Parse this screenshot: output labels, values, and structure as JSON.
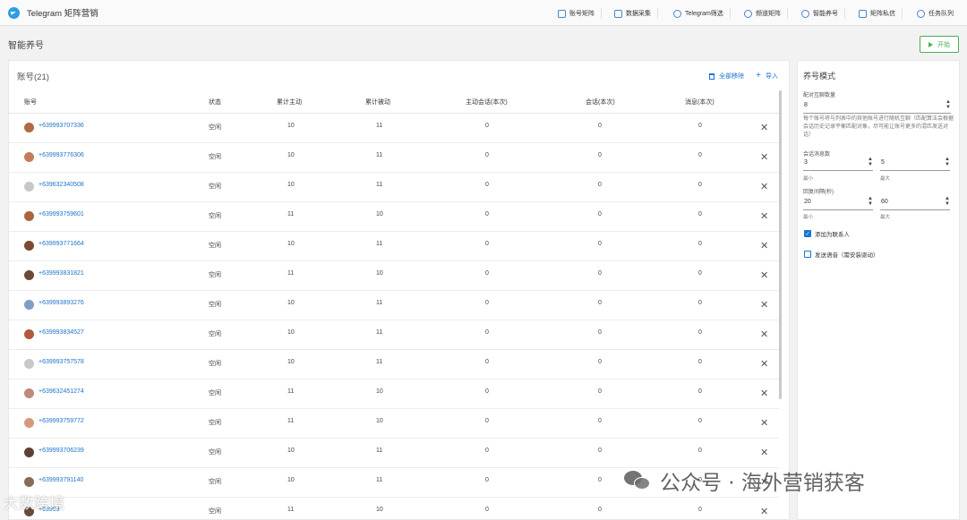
{
  "app": {
    "title": "Telegram 矩阵营销"
  },
  "nav": [
    {
      "label": "账号矩阵"
    },
    {
      "label": "数据采集"
    },
    {
      "label": "Telegram筛选"
    },
    {
      "label": "频道矩阵"
    },
    {
      "label": "智能养号"
    },
    {
      "label": "矩阵私信"
    },
    {
      "label": "任务队列"
    }
  ],
  "page": {
    "title": "智能养号",
    "start_label": "开始"
  },
  "accounts": {
    "title": "账号(21)",
    "remove_all_label": "全部移除",
    "import_label": "导入",
    "columns": [
      "账号",
      "状态",
      "累计主动",
      "累计被动",
      "主动会话(本次)",
      "会话(本次)",
      "消息(本次)"
    ],
    "rows": [
      {
        "phone": "+639993707336",
        "status": "空闲",
        "active_total": "10",
        "passive_total": "11",
        "active_sessions": "0",
        "sessions": "0",
        "messages": "0",
        "avatar": "#b06a45"
      },
      {
        "phone": "+639993776306",
        "status": "空闲",
        "active_total": "10",
        "passive_total": "11",
        "active_sessions": "0",
        "sessions": "0",
        "messages": "0",
        "avatar": "#c77a5a"
      },
      {
        "phone": "+639632340508",
        "status": "空闲",
        "active_total": "10",
        "passive_total": "11",
        "active_sessions": "0",
        "sessions": "0",
        "messages": "0",
        "avatar": "#c8c8c8"
      },
      {
        "phone": "+639993759601",
        "status": "空闲",
        "active_total": "11",
        "passive_total": "10",
        "active_sessions": "0",
        "sessions": "0",
        "messages": "0",
        "avatar": "#a9653f"
      },
      {
        "phone": "+639993771664",
        "status": "空闲",
        "active_total": "10",
        "passive_total": "11",
        "active_sessions": "0",
        "sessions": "0",
        "messages": "0",
        "avatar": "#7a4a32"
      },
      {
        "phone": "+639993831821",
        "status": "空闲",
        "active_total": "11",
        "passive_total": "10",
        "active_sessions": "0",
        "sessions": "0",
        "messages": "0",
        "avatar": "#6b4a36"
      },
      {
        "phone": "+639993893276",
        "status": "空闲",
        "active_total": "10",
        "passive_total": "11",
        "active_sessions": "0",
        "sessions": "0",
        "messages": "0",
        "avatar": "#7f9fc4"
      },
      {
        "phone": "+639993834527",
        "status": "空闲",
        "active_total": "10",
        "passive_total": "11",
        "active_sessions": "0",
        "sessions": "0",
        "messages": "0",
        "avatar": "#b2593b"
      },
      {
        "phone": "+639993757578",
        "status": "空闲",
        "active_total": "10",
        "passive_total": "11",
        "active_sessions": "0",
        "sessions": "0",
        "messages": "0",
        "avatar": "#c8c8c8"
      },
      {
        "phone": "+639632451274",
        "status": "空闲",
        "active_total": "11",
        "passive_total": "10",
        "active_sessions": "0",
        "sessions": "0",
        "messages": "0",
        "avatar": "#c08a78"
      },
      {
        "phone": "+639993759772",
        "status": "空闲",
        "active_total": "11",
        "passive_total": "10",
        "active_sessions": "0",
        "sessions": "0",
        "messages": "0",
        "avatar": "#d49a7e"
      },
      {
        "phone": "+639993706239",
        "status": "空闲",
        "active_total": "10",
        "passive_total": "11",
        "active_sessions": "0",
        "sessions": "0",
        "messages": "0",
        "avatar": "#5e4032"
      },
      {
        "phone": "+639993791140",
        "status": "空闲",
        "active_total": "10",
        "passive_total": "11",
        "active_sessions": "0",
        "sessions": "0",
        "messages": "0",
        "avatar": "#8a6a5a"
      },
      {
        "phone": "+63999",
        "status": "空闲",
        "active_total": "11",
        "passive_total": "10",
        "active_sessions": "0",
        "sessions": "0",
        "messages": "0",
        "avatar": "#6a4a3a"
      }
    ]
  },
  "settings": {
    "title": "养号模式",
    "pair_count_label": "配对互聊数量",
    "pair_count_value": "8",
    "description": "每个账号将与列表中的其他账号进行随机互聊（匹配算法会根据会话历史记录平衡匹配对象，尽可能让账号更多的混匹发送对话）",
    "msg_count_label": "会话消息数",
    "msg_min": "3",
    "msg_max": "5",
    "min_label": "最小",
    "max_label": "最大",
    "reply_interval_label": "回复间隔(秒)",
    "interval_min": "20",
    "interval_max": "60",
    "add_contact_label": "添加为联系人",
    "add_contact_checked": true,
    "send_voice_label": "发送语音（需安装驱动）",
    "send_voice_checked": false
  },
  "watermarks": {
    "left": "大数跨境",
    "right": "公众号 · 海外营销获客"
  }
}
